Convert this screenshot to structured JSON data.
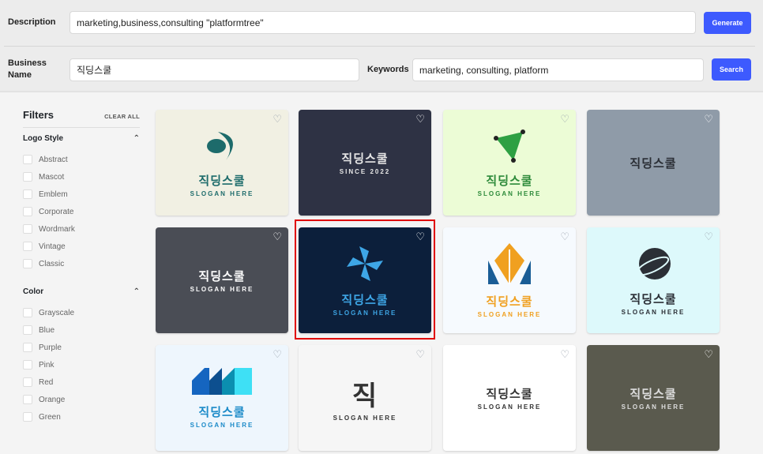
{
  "header": {
    "description_label": "Description",
    "description_value": "marketing,business,consulting \"platformtree\"",
    "generate_label": "Generate",
    "business_name_label": "Business Name",
    "business_name_value": "직딩스쿨",
    "keywords_label": "Keywords",
    "keywords_value": "marketing, consulting, platform",
    "search_label": "Search",
    "accent": "#3d5afe"
  },
  "filters": {
    "title": "Filters",
    "clear_all": "CLEAR ALL",
    "logo_style": {
      "title": "Logo Style",
      "options": [
        "Abstract",
        "Mascot",
        "Emblem",
        "Corporate",
        "Wordmark",
        "Vintage",
        "Classic"
      ]
    },
    "color": {
      "title": "Color",
      "options": [
        "Grayscale",
        "Blue",
        "Purple",
        "Pink",
        "Red",
        "Orange",
        "Green"
      ]
    }
  },
  "logos": [
    {
      "name": "직딩스쿨",
      "slogan": "SLOGAN HERE",
      "bg": "#f1f0e3",
      "fg": "#1d6b6b",
      "icon": "swirl-icon",
      "heart": "#9aa3ad"
    },
    {
      "name": "직딩스쿨",
      "slogan": "SINCE 2022",
      "bg": "#2e3244",
      "fg": "#e6e6e6",
      "icon": "",
      "heart": "#ffffff"
    },
    {
      "name": "직딩스쿨",
      "slogan": "SLOGAN HERE",
      "bg": "#ecfcd6",
      "fg": "#2d8a3a",
      "icon": "triangle-icon",
      "heart": "#9aa3ad"
    },
    {
      "name": "직딩스쿨",
      "slogan": "",
      "bg": "#8f9ba8",
      "fg": "#2b2f36",
      "icon": "",
      "heart": "#ffffff"
    },
    {
      "name": "직딩스쿨",
      "slogan": "SLOGAN HERE",
      "bg": "#4a4d55",
      "fg": "#ffffff",
      "icon": "",
      "heart": "#ffffff"
    },
    {
      "name": "직딩스쿨",
      "slogan": "SLOGAN HERE",
      "bg": "#0c1f3b",
      "fg": "#3ea6e6",
      "icon": "pinwheel-icon",
      "heart": "#ffffff"
    },
    {
      "name": "직딩스쿨",
      "slogan": "SLOGAN HERE",
      "bg": "#f6fafe",
      "fg": "#f0a020",
      "icon": "arrow-icon",
      "heart": "#9aa3ad"
    },
    {
      "name": "직딩스쿨",
      "slogan": "SLOGAN HERE",
      "bg": "#ddf9fb",
      "fg": "#2b2f36",
      "icon": "planet-icon",
      "heart": "#9aa3ad"
    },
    {
      "name": "직딩스쿨",
      "slogan": "SLOGAN HERE",
      "bg": "#eef6fd",
      "fg": "#1b8ac8",
      "icon": "building-icon",
      "heart": "#9aa3ad"
    },
    {
      "name": "직",
      "slogan": "SLOGAN HERE",
      "bg": "#f6f6f6",
      "fg": "#333333",
      "icon": "",
      "heart": "#9aa3ad"
    },
    {
      "name": "직딩스쿨",
      "slogan": "SLOGAN HERE",
      "bg": "#ffffff",
      "fg": "#333333",
      "icon": "",
      "heart": "#9aa3ad"
    },
    {
      "name": "직딩스쿨",
      "slogan": "SLOGAN HERE",
      "bg": "#5a5a4e",
      "fg": "#dddddd",
      "icon": "",
      "heart": "#ffffff"
    }
  ],
  "selected_index": 5
}
